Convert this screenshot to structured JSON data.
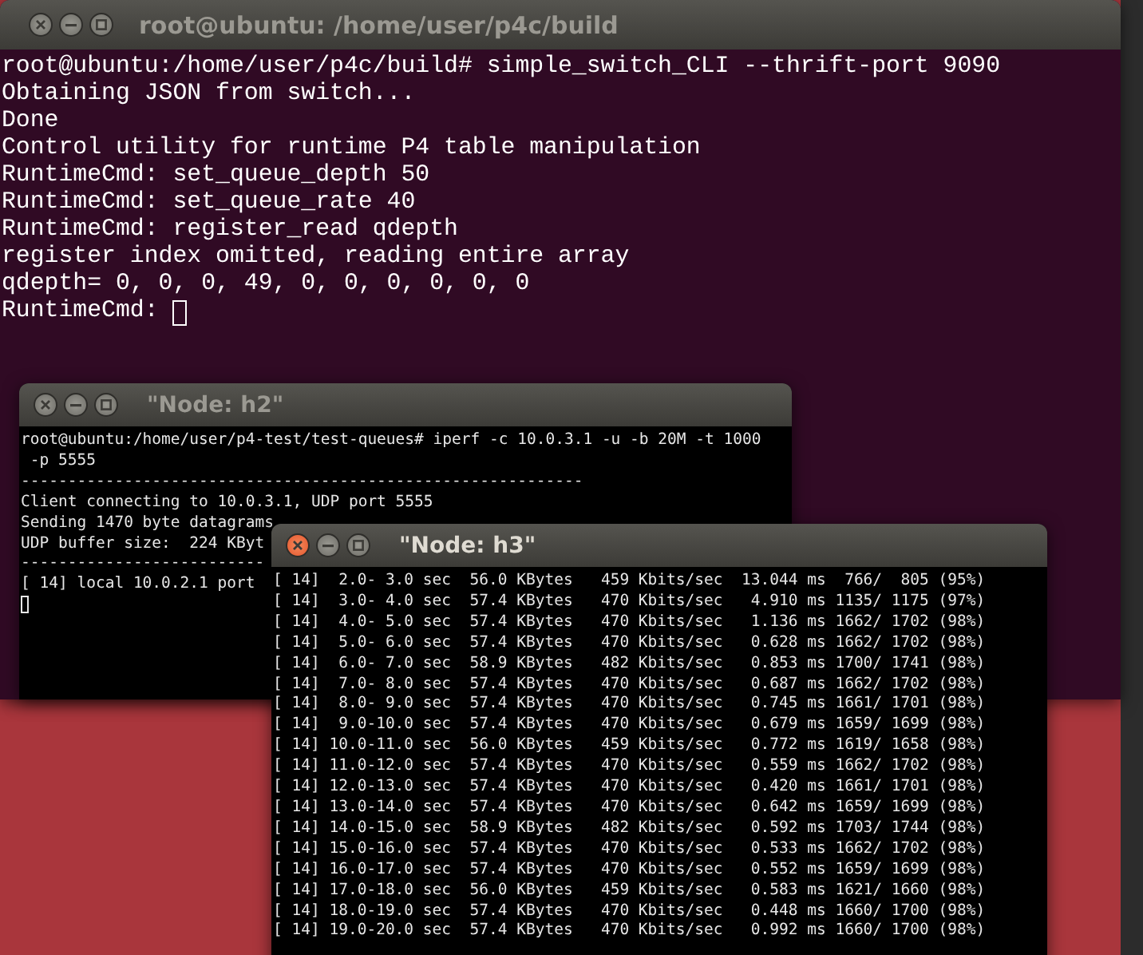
{
  "windows": [
    {
      "title": "root@ubuntu: /home/user/p4c/build",
      "active": false,
      "kind": "gnome",
      "cursor": true,
      "lines": [
        "root@ubuntu:/home/user/p4c/build# simple_switch_CLI --thrift-port 9090",
        "Obtaining JSON from switch...",
        "Done",
        "Control utility for runtime P4 table manipulation",
        "RuntimeCmd: set_queue_depth 50",
        "RuntimeCmd: set_queue_rate 40",
        "RuntimeCmd: register_read qdepth",
        "register index omitted, reading entire array",
        "qdepth= 0, 0, 0, 49, 0, 0, 0, 0, 0, 0",
        "RuntimeCmd: "
      ]
    },
    {
      "title": "\"Node: h2\"",
      "active": false,
      "kind": "xterm",
      "cursor": true,
      "lines": [
        "root@ubuntu:/home/user/p4-test/test-queues# iperf -c 10.0.3.1 -u -b 20M -t 1000",
        " -p 5555",
        "------------------------------------------------------------",
        "Client connecting to 10.0.3.1, UDP port 5555",
        "Sending 1470 byte datagrams",
        "UDP buffer size:  224 KByt",
        "--------------------------",
        "[ 14] local 10.0.2.1 port"
      ]
    },
    {
      "title": "\"Node: h3\"",
      "active": true,
      "kind": "xterm",
      "cursor": false,
      "lines": [
        "[ 14]  2.0- 3.0 sec  56.0 KBytes   459 Kbits/sec  13.044 ms  766/  805 (95%)",
        "[ 14]  3.0- 4.0 sec  57.4 KBytes   470 Kbits/sec   4.910 ms 1135/ 1175 (97%)",
        "[ 14]  4.0- 5.0 sec  57.4 KBytes   470 Kbits/sec   1.136 ms 1662/ 1702 (98%)",
        "[ 14]  5.0- 6.0 sec  57.4 KBytes   470 Kbits/sec   0.628 ms 1662/ 1702 (98%)",
        "[ 14]  6.0- 7.0 sec  58.9 KBytes   482 Kbits/sec   0.853 ms 1700/ 1741 (98%)",
        "[ 14]  7.0- 8.0 sec  57.4 KBytes   470 Kbits/sec   0.687 ms 1662/ 1702 (98%)",
        "[ 14]  8.0- 9.0 sec  57.4 KBytes   470 Kbits/sec   0.745 ms 1661/ 1701 (98%)",
        "[ 14]  9.0-10.0 sec  57.4 KBytes   470 Kbits/sec   0.679 ms 1659/ 1699 (98%)",
        "[ 14] 10.0-11.0 sec  56.0 KBytes   459 Kbits/sec   0.772 ms 1619/ 1658 (98%)",
        "[ 14] 11.0-12.0 sec  57.4 KBytes   470 Kbits/sec   0.559 ms 1662/ 1702 (98%)",
        "[ 14] 12.0-13.0 sec  57.4 KBytes   470 Kbits/sec   0.420 ms 1661/ 1701 (98%)",
        "[ 14] 13.0-14.0 sec  57.4 KBytes   470 Kbits/sec   0.642 ms 1659/ 1699 (98%)",
        "[ 14] 14.0-15.0 sec  58.9 KBytes   482 Kbits/sec   0.592 ms 1703/ 1744 (98%)",
        "[ 14] 15.0-16.0 sec  57.4 KBytes   470 Kbits/sec   0.533 ms 1662/ 1702 (98%)",
        "[ 14] 16.0-17.0 sec  57.4 KBytes   470 Kbits/sec   0.552 ms 1659/ 1699 (98%)",
        "[ 14] 17.0-18.0 sec  56.0 KBytes   459 Kbits/sec   0.583 ms 1621/ 1660 (98%)",
        "[ 14] 18.0-19.0 sec  57.4 KBytes   470 Kbits/sec   0.448 ms 1660/ 1700 (98%)",
        "[ 14] 19.0-20.0 sec  57.4 KBytes   470 Kbits/sec   0.992 ms 1660/ 1700 (98%)"
      ]
    }
  ]
}
